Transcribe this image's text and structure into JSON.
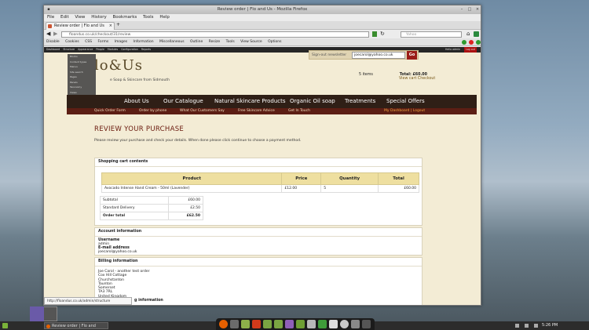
{
  "window": {
    "title": "Review order | Flo and Us - Mozilla Firefox"
  },
  "menu": [
    "File",
    "Edit",
    "View",
    "History",
    "Bookmarks",
    "Tools",
    "Help"
  ],
  "tab": {
    "label": "Review order | Flo and Us",
    "new_tab": "+"
  },
  "url": {
    "value": "floandus.co.uk/checkout/31/review",
    "search_placeholder": "Yahoo"
  },
  "devbar": [
    "Disable",
    "Cookies",
    "CSS",
    "Forms",
    "Images",
    "Information",
    "Miscellaneous",
    "Outline",
    "Resize",
    "Tools",
    "View Source",
    "Options"
  ],
  "admin_bar": [
    "Dashboard",
    "Structure",
    "Appearance",
    "People",
    "Modules",
    "Configuration",
    "Reports"
  ],
  "admin_right": [
    "Hello admin",
    "Log out"
  ],
  "dropdown": [
    "Blocks",
    "Content types",
    "Menus",
    "Site search",
    "Pages",
    "Panels",
    "Taxonomy",
    "Views",
    "Quicklinks",
    "Scheduling"
  ],
  "site": {
    "logo": "lo&Us",
    "tagline": "e Soap & Skincare from Sidmouth"
  },
  "login": {
    "label": "Sign-out newsletter",
    "email": "joecarol@yahoo.co.uk",
    "go": "Go"
  },
  "basket": {
    "items": "5 items",
    "total_label": "Total: £60.00",
    "view_cart": "View cart",
    "checkout": "Checkout"
  },
  "nav": [
    "About Us",
    "Our Catalogue",
    "Natural Skincare Products",
    "Organic Oil soap",
    "Treatments",
    "Special Offers"
  ],
  "subnav": [
    "Quick Order Form",
    "Order by phone",
    "What Our Customers Say",
    "Free Skincare Advice",
    "Get In Touch"
  ],
  "user_links": "My Dashboard | Logout",
  "heading": "REVIEW YOUR PURCHASE",
  "intro": "Please review your purchase and check your details. When done please click continue to choose a payment method.",
  "cart": {
    "title": "Shopping cart contents",
    "headers": [
      "Product",
      "Price",
      "Quantity",
      "Total"
    ],
    "rows": [
      {
        "product": "Avocado Intense Hand Cream - 50ml (Lavender)",
        "price": "£12.00",
        "qty": "5",
        "total": "£60.00"
      }
    ],
    "totals": [
      {
        "label": "Subtotal",
        "value": "£60.00"
      },
      {
        "label": "Standard Delivery",
        "value": "£2.50"
      },
      {
        "label": "Order total",
        "value": "£62.50"
      }
    ]
  },
  "account": {
    "title": "Account information",
    "username_label": "Username",
    "username": "admin",
    "email_label": "E-mail address",
    "email": "joecarol@yahoo.co.uk"
  },
  "billing": {
    "title": "Billing information",
    "lines": [
      "Joe Carol - another test order",
      "Cox Hill Cottage",
      "Churchstanton",
      "Taunton",
      "Somerset",
      "TA3 7RL",
      "United Kingdom"
    ]
  },
  "next_section": "g information",
  "status_url": "http://floandus.co.uk/admin/structure",
  "taskbar": {
    "item": "Review order | Flo and",
    "clock": "5:26 PM"
  }
}
